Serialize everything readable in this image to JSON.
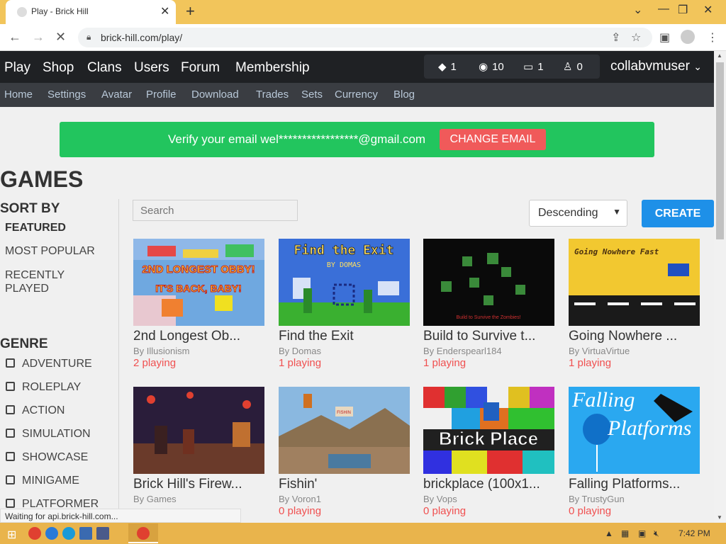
{
  "browser": {
    "tab_title": "Play - Brick Hill",
    "tab_close": "✕",
    "new_tab": "+",
    "url": "brick-hill.com/play/",
    "status": "Waiting for api.brick-hill.com..."
  },
  "site": {
    "main_nav": [
      "Play",
      "Shop",
      "Clans",
      "Users",
      "Forum",
      "Membership"
    ],
    "stats": {
      "bricks": "1",
      "bits": "10",
      "messages": "1",
      "friends": "0"
    },
    "username": "collabvmuser",
    "sub_nav": [
      "Home",
      "Settings",
      "Avatar",
      "Profile",
      "Download",
      "Trades",
      "Sets",
      "Currency",
      "Blog"
    ],
    "verify": {
      "text": "Verify your email wel*****************@gmail.com",
      "button": "CHANGE EMAIL"
    }
  },
  "games": {
    "title": "GAMES",
    "sort_title": "SORT BY",
    "sort_options": [
      "FEATURED",
      "MOST POPULAR",
      "RECENTLY PLAYED"
    ],
    "genre_title": "GENRE",
    "genres": [
      "ADVENTURE",
      "ROLEPLAY",
      "ACTION",
      "SIMULATION",
      "SHOWCASE",
      "MINIGAME",
      "PLATFORMER"
    ],
    "search_placeholder": "Search",
    "order": "Descending",
    "create_label": "CREATE",
    "cards": [
      {
        "title": "2nd Longest Ob...",
        "by": "By Illusionism",
        "playing": "2 playing"
      },
      {
        "title": "Find the Exit",
        "by": "By Domas",
        "playing": "1 playing"
      },
      {
        "title": "Build to Survive t...",
        "by": "By Enderspearl184",
        "playing": "1 playing"
      },
      {
        "title": "Going Nowhere ...",
        "by": "By VirtuaVirtue",
        "playing": "1 playing"
      },
      {
        "title": "Brick Hill's Firew...",
        "by": "By Games",
        "playing": ""
      },
      {
        "title": "Fishin'",
        "by": "By Voron1",
        "playing": "0 playing"
      },
      {
        "title": "brickplace (100x1...",
        "by": "By Vops",
        "playing": "0 playing"
      },
      {
        "title": "Falling Platforms...",
        "by": "By TrustyGun",
        "playing": "0 playing"
      }
    ],
    "thumb_texts": {
      "obby_line1": "2ND LONGEST OBBY!",
      "obby_line2": "IT'S BACK, BABY!",
      "exit_line1": "Find the Exit",
      "exit_line2": "BY DOMAS",
      "build_line": "Build to Survive the Zombies!",
      "nowhere_line": "Going Nowhere Fast",
      "brickplace_line": "Brick Place",
      "falling_line1": "Falling",
      "falling_line2": "Platforms",
      "fishin_sign": "FISHIN"
    }
  },
  "taskbar": {
    "time": "7:42 PM"
  }
}
